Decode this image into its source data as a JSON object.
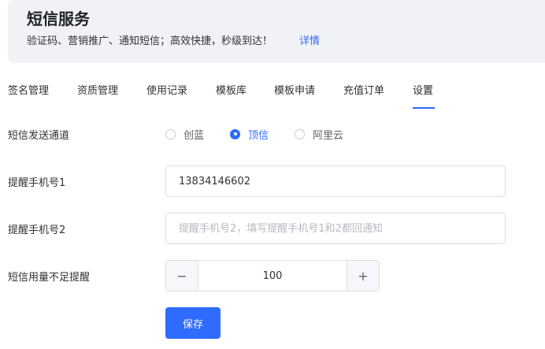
{
  "header": {
    "title": "短信服务",
    "description": "验证码、营销推广、通知短信；高效快捷，秒级到达！",
    "link_label": "详情"
  },
  "tabs": [
    {
      "label": "签名管理",
      "active": false
    },
    {
      "label": "资质管理",
      "active": false
    },
    {
      "label": "使用记录",
      "active": false
    },
    {
      "label": "模板库",
      "active": false
    },
    {
      "label": "模板申请",
      "active": false
    },
    {
      "label": "充值订单",
      "active": false
    },
    {
      "label": "设置",
      "active": true
    }
  ],
  "form": {
    "channel": {
      "label": "短信发送通道",
      "options": [
        {
          "label": "创蓝",
          "checked": false
        },
        {
          "label": "顶信",
          "checked": true
        },
        {
          "label": "阿里云",
          "checked": false
        }
      ]
    },
    "phone1": {
      "label": "提醒手机号1",
      "value": "13834146602",
      "placeholder": ""
    },
    "phone2": {
      "label": "提醒手机号2",
      "value": "",
      "placeholder": "提醒手机号2，填写提醒手机号1和2都回通知"
    },
    "threshold": {
      "label": "短信用量不足提醒",
      "value": "100",
      "minus_symbol": "−",
      "plus_symbol": "+"
    },
    "save_label": "保存"
  },
  "colors": {
    "accent": "#2f6bff",
    "header_bg": "#f0f2f6",
    "border": "#dcdfe6"
  }
}
